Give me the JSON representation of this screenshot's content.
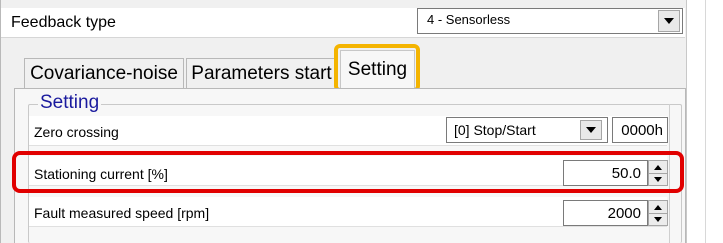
{
  "feedback": {
    "label": "Feedback type",
    "selected": "4 - Sensorless"
  },
  "tabs": [
    {
      "label": "Covariance-noise"
    },
    {
      "label": "Parameters start"
    },
    {
      "label": "Setting",
      "selected": true
    }
  ],
  "group": {
    "title": "Setting"
  },
  "rows": {
    "zero_crossing": {
      "label": "Zero crossing",
      "selected": "[0] Stop/Start",
      "hex": "0000h"
    },
    "stationing_current": {
      "label": "Stationing current [%]",
      "value": "50.0"
    },
    "fault_speed": {
      "label": "Fault measured speed [rpm]",
      "value": "2000"
    }
  },
  "colors": {
    "tab_highlight": "#f4b400",
    "row_highlight": "#e10000",
    "group_title": "#1a1a9e"
  }
}
